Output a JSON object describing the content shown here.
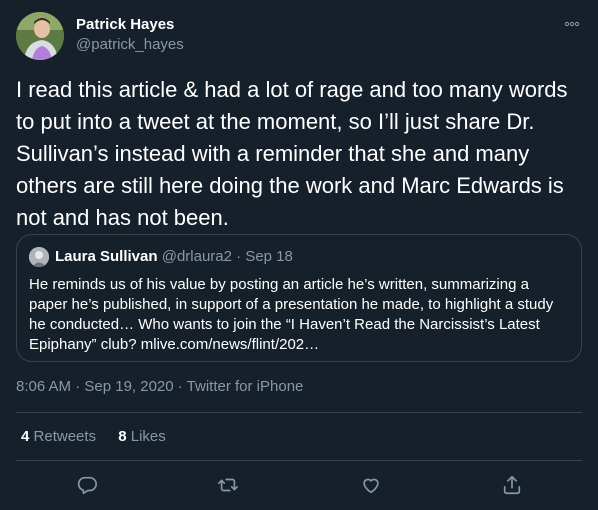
{
  "author": {
    "name": "Patrick Hayes",
    "handle": "@patrick_hayes"
  },
  "tweet_text": "I read this article & had a lot of rage and too many words to put into a tweet at the moment, so I’ll just share Dr. Sullivan’s instead with a reminder that she and many others are still here doing the work and Marc Edwards is not and has not been.",
  "quoted": {
    "name": "Laura Sullivan",
    "handle": "@drlaura2",
    "separator": " · ",
    "date": "Sep 18",
    "text": "He reminds us of his value by posting an article he’s written, summarizing a paper he’s published, in support of a presentation he made, to highlight a study he conducted… Who wants to join the “I Haven’t Read the Narcissist’s Latest Epiphany” club? mlive.com/news/flint/202…"
  },
  "timestamp": "8:06 AM · Sep 19, 2020 · Twitter for iPhone",
  "stats": {
    "retweets_count": "4",
    "retweets_label": "Retweets",
    "likes_count": "8",
    "likes_label": "Likes"
  },
  "icons": {
    "more": "more-dots-icon",
    "reply": "reply-icon",
    "retweet": "retweet-icon",
    "like": "heart-icon",
    "share": "share-icon"
  },
  "colors": {
    "background": "#15202b",
    "secondary_text": "#8899a6",
    "border": "#38444d"
  }
}
